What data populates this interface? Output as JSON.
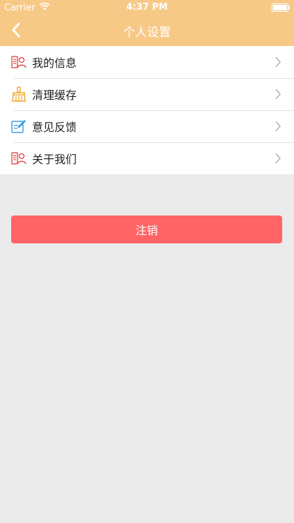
{
  "status_bar": {
    "carrier": "Carrier",
    "time": "4:37 PM",
    "wifi_icon": "wifi-icon",
    "battery_icon": "battery-icon"
  },
  "nav": {
    "title": "个人设置",
    "back_icon": "chevron-left-icon"
  },
  "menu": {
    "items": [
      {
        "label": "我的信息",
        "icon": "person-card-icon"
      },
      {
        "label": "清理缓存",
        "icon": "broom-icon"
      },
      {
        "label": "意见反馈",
        "icon": "edit-note-icon"
      },
      {
        "label": "关于我们",
        "icon": "person-card-icon"
      }
    ]
  },
  "actions": {
    "logout_label": "注销"
  },
  "colors": {
    "header": "#f7c987",
    "logout": "#ff6565",
    "background": "#ebebeb",
    "icon_red": "#e8504f",
    "icon_orange": "#f0a82b",
    "icon_blue": "#3a9ee8"
  }
}
